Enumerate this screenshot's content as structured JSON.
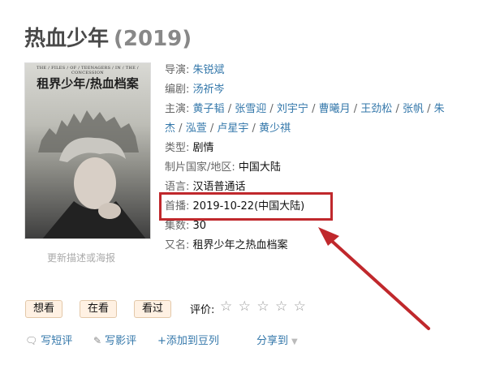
{
  "movie": {
    "title": "热血少年",
    "year": "(2019)"
  },
  "poster": {
    "top_strip": "THE / FILES / OF / TEENAGERS / IN / THE / CONCESSION",
    "title": "租界少年/热血档案",
    "update_link": "更新描述或海报"
  },
  "info": {
    "director_label": "导演:",
    "director": "朱锐斌",
    "writer_label": "编剧:",
    "writer": "汤祈岑",
    "cast_label": "主演:",
    "cast_line1": [
      "黄子韬",
      "张雪迎",
      "刘宇宁",
      "曹曦月",
      "王劲松",
      "张帆"
    ],
    "cast_line1_tail": "朱",
    "cast_line2_head": "杰",
    "cast_line2": [
      "泓萱",
      "卢星宇",
      "黄少祺"
    ],
    "separator": "/",
    "genre_label": "类型:",
    "genre": "剧情",
    "region_label": "制片国家/地区:",
    "region": "中国大陆",
    "language_label": "语言:",
    "language": "汉语普通话",
    "premiere_label": "首播:",
    "premiere": "2019-10-22(中国大陆)",
    "episodes_label": "集数:",
    "episodes": "30",
    "aka_label": "又名:",
    "aka": "租界少年之热血档案"
  },
  "buttons": {
    "want": "想看",
    "watching": "在看",
    "watched": "看过",
    "rating_label": "评价:",
    "stars": [
      "☆",
      "☆",
      "☆",
      "☆",
      "☆"
    ]
  },
  "actions": {
    "short_review": "写短评",
    "review": "写影评",
    "add_doulist": "+添加到豆列",
    "share": "分享到"
  },
  "colors": {
    "link": "#3377aa",
    "highlight": "#c0282c",
    "button_bg": "#fff1e3"
  }
}
